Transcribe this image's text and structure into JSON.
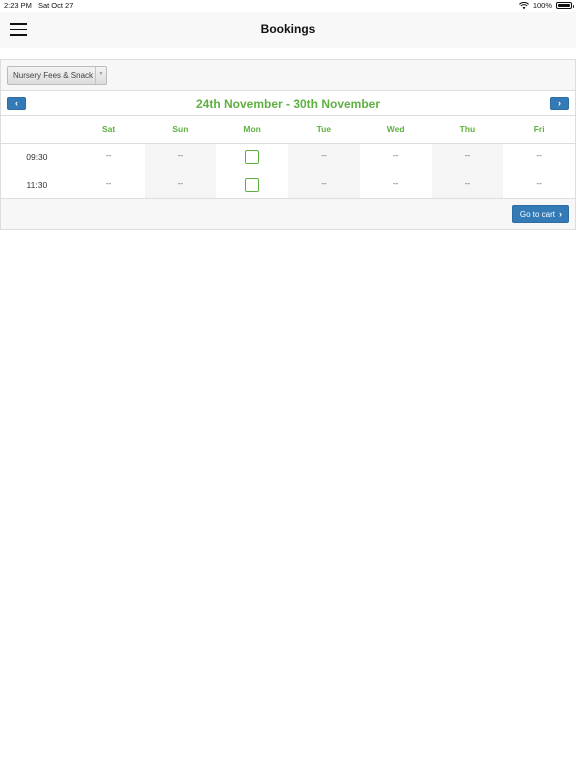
{
  "status_bar": {
    "time": "2:23 PM",
    "date": "Sat Oct 27",
    "battery": "100%"
  },
  "nav": {
    "title": "Bookings"
  },
  "booking": {
    "service": "Nursery Fees & Snack",
    "week_range": "24th November - 30th November",
    "prev_icon": "chevron-left-icon",
    "next_icon": "chevron-right-icon",
    "days": [
      "Sat",
      "Sun",
      "Mon",
      "Tue",
      "Wed",
      "Thu",
      "Fri"
    ],
    "slots": [
      {
        "time": "09:30",
        "cells": [
          "--",
          "--",
          "checkbox",
          "--",
          "--",
          "--",
          "--"
        ]
      },
      {
        "time": "11:30",
        "cells": [
          "--",
          "--",
          "checkbox",
          "--",
          "--",
          "--",
          "--"
        ]
      }
    ],
    "cart_label": "Go to cart"
  },
  "colors": {
    "accent_green": "#5fb041",
    "button_blue": "#337ab7"
  }
}
